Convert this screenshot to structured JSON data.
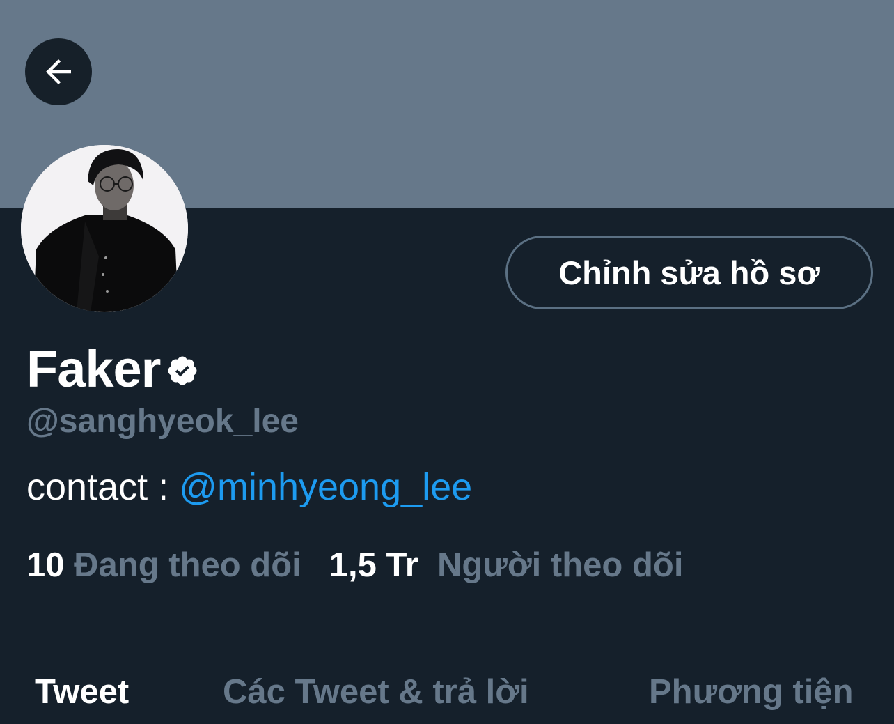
{
  "profile": {
    "display_name": "Faker",
    "handle": "@sanghyeok_lee",
    "bio_prefix": "contact : ",
    "bio_mention": "@minhyeong_lee",
    "edit_button_label": "Chỉnh sửa hồ sơ",
    "following_count": "10",
    "following_label": "Đang theo dõi",
    "followers_count": "1,5 Tr",
    "followers_label": "Người theo dõi"
  },
  "tabs": [
    {
      "label": "Tweet",
      "active": true
    },
    {
      "label": "Các Tweet & trả lời",
      "active": false
    },
    {
      "label": "Phương tiện",
      "active": false
    }
  ],
  "icons": {
    "back": "arrow-left-icon",
    "verified": "verified-badge-icon"
  },
  "colors": {
    "background": "#15202b",
    "banner": "#66788a",
    "muted_text": "#66788a",
    "accent": "#1d9bf0",
    "text": "#ffffff"
  }
}
